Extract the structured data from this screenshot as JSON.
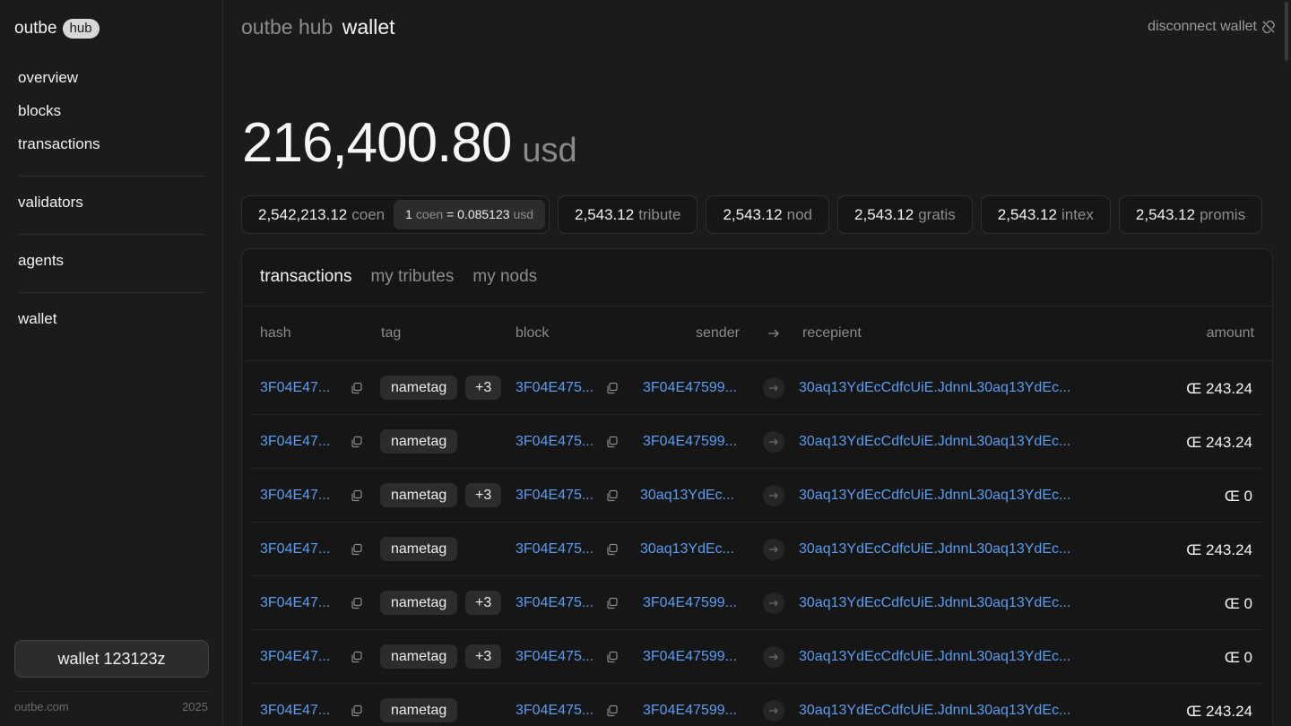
{
  "brand": {
    "name": "outbe",
    "badge": "hub"
  },
  "nav": [
    "overview",
    "blocks",
    "transactions",
    "validators",
    "agents",
    "wallet"
  ],
  "wallet_button": "wallet 123123z",
  "footer": {
    "site": "outbe.com",
    "year": "2025"
  },
  "header": {
    "prefix": "outbe hub",
    "title": "wallet",
    "disconnect": "disconnect wallet"
  },
  "balance": {
    "value": "216,400.80",
    "unit": "usd"
  },
  "chips": {
    "coen": {
      "value": "2,542,213.12",
      "unit": "coen",
      "rate_lead": "1",
      "rate_unit": "coen",
      "rate_eq": "= 0.085123",
      "rate_to": "usd"
    },
    "tribute": {
      "value": "2,543.12",
      "unit": "tribute"
    },
    "nod": {
      "value": "2,543.12",
      "unit": "nod"
    },
    "gratis": {
      "value": "2,543.12",
      "unit": "gratis"
    },
    "intex": {
      "value": "2,543.12",
      "unit": "intex"
    },
    "promis": {
      "value": "2,543.12",
      "unit": "promis"
    }
  },
  "tabs": [
    "transactions",
    "my tributes",
    "my nods"
  ],
  "columns": {
    "hash": "hash",
    "tag": "tag",
    "block": "block",
    "sender": "sender",
    "recipient": "recepient",
    "amount": "amount"
  },
  "rows": [
    {
      "hash": "3F04E47...",
      "tag": "nametag",
      "extra": "+3",
      "block": "3F04E475...",
      "sender": "3F04E47599...",
      "recipient": "30aq13YdEcCdfcUiE.JdnnL30aq13YdEc...",
      "amount": "Œ 243.24"
    },
    {
      "hash": "3F04E47...",
      "tag": "nametag",
      "extra": "",
      "block": "3F04E475...",
      "sender": "3F04E47599...",
      "recipient": "30aq13YdEcCdfcUiE.JdnnL30aq13YdEc...",
      "amount": "Œ 243.24"
    },
    {
      "hash": "3F04E47...",
      "tag": "nametag",
      "extra": "+3",
      "block": "3F04E475...",
      "sender": "30aq13YdEc...",
      "recipient": "30aq13YdEcCdfcUiE.JdnnL30aq13YdEc...",
      "amount": "Œ 0"
    },
    {
      "hash": "3F04E47...",
      "tag": "nametag",
      "extra": "",
      "block": "3F04E475...",
      "sender": "30aq13YdEc...",
      "recipient": "30aq13YdEcCdfcUiE.JdnnL30aq13YdEc...",
      "amount": "Œ 243.24"
    },
    {
      "hash": "3F04E47...",
      "tag": "nametag",
      "extra": "+3",
      "block": "3F04E475...",
      "sender": "3F04E47599...",
      "recipient": "30aq13YdEcCdfcUiE.JdnnL30aq13YdEc...",
      "amount": "Œ 0"
    },
    {
      "hash": "3F04E47...",
      "tag": "nametag",
      "extra": "+3",
      "block": "3F04E475...",
      "sender": "3F04E47599...",
      "recipient": "30aq13YdEcCdfcUiE.JdnnL30aq13YdEc...",
      "amount": "Œ 0"
    },
    {
      "hash": "3F04E47...",
      "tag": "nametag",
      "extra": "",
      "block": "3F04E475...",
      "sender": "3F04E47599...",
      "recipient": "30aq13YdEcCdfcUiE.JdnnL30aq13YdEc...",
      "amount": "Œ 243.24"
    }
  ]
}
